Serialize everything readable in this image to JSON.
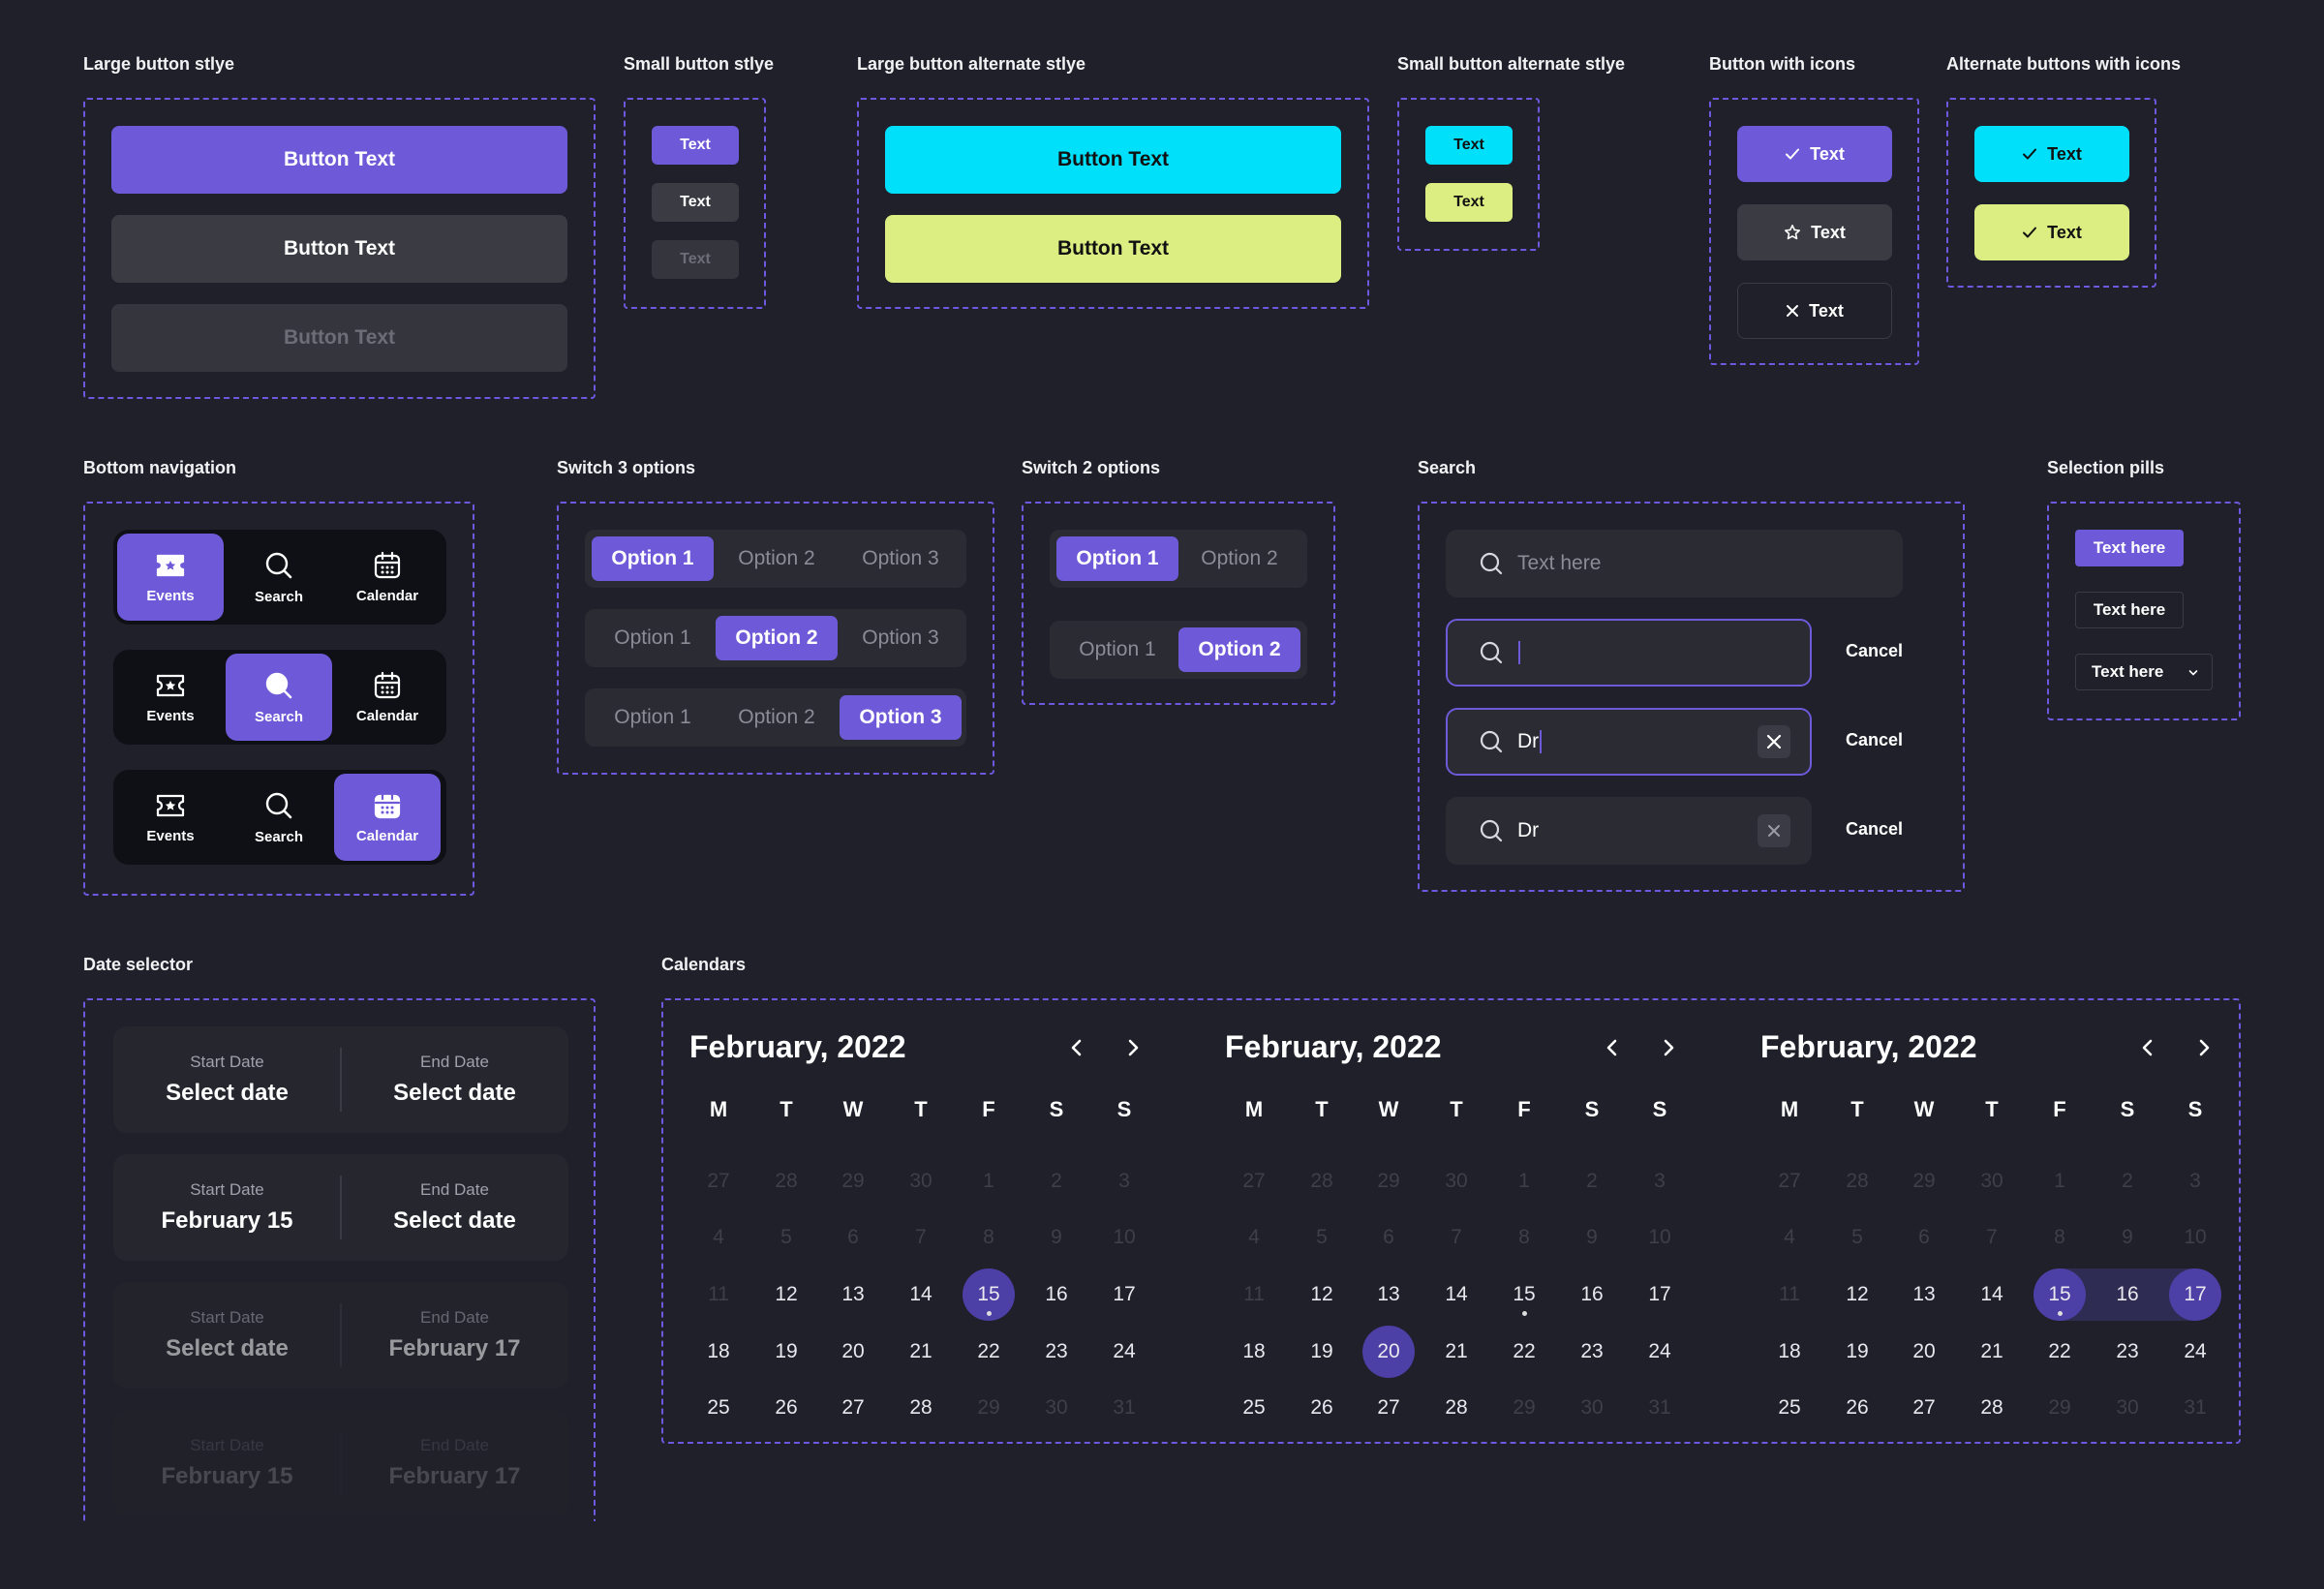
{
  "titles": {
    "large_button": "Large button stlye",
    "small_button": "Small button stlye",
    "large_alt": "Large button alternate stlye",
    "small_alt": "Small button alternate stlye",
    "button_icons": "Button with icons",
    "alt_icons": "Alternate buttons with icons",
    "bottom_nav": "Bottom navigation",
    "switch3": "Switch 3 options",
    "switch2": "Switch 2 options",
    "search": "Search",
    "pills": "Selection pills",
    "date_selector": "Date selector",
    "calendars": "Calendars"
  },
  "large_buttons": [
    "Button Text",
    "Button Text",
    "Button Text"
  ],
  "small_buttons": [
    "Text",
    "Text",
    "Text"
  ],
  "large_alt_buttons": [
    "Button Text",
    "Button Text"
  ],
  "small_alt_buttons": [
    "Text",
    "Text"
  ],
  "icon_buttons": [
    "Text",
    "Text",
    "Text"
  ],
  "alt_icon_buttons": [
    "Text",
    "Text"
  ],
  "bottom_nav": {
    "items": [
      "Events",
      "Search",
      "Calendar"
    ],
    "active_per_row": [
      0,
      1,
      2
    ]
  },
  "switch3": {
    "options": [
      "Option 1",
      "Option 2",
      "Option 3"
    ],
    "selected_per_row": [
      0,
      1,
      2
    ]
  },
  "switch2": {
    "options": [
      "Option 1",
      "Option 2"
    ],
    "selected_per_row": [
      0,
      1
    ]
  },
  "search": {
    "placeholder": "Text here",
    "typed": "Dr",
    "cancel": "Cancel"
  },
  "pills": [
    "Text here",
    "Text here",
    "Text here"
  ],
  "date_selector": {
    "start_caption": "Start Date",
    "end_caption": "End Date",
    "rows": [
      {
        "start": "Select date",
        "end": "Select date"
      },
      {
        "start": "February 15",
        "end": "Select date"
      },
      {
        "start": "Select date",
        "end": "February 17"
      },
      {
        "start": "February 15",
        "end": "February 17"
      }
    ]
  },
  "calendar": {
    "title": "February, 2022",
    "weekdays": [
      "M",
      "T",
      "W",
      "T",
      "F",
      "S",
      "S"
    ],
    "weeks": [
      [
        "27",
        "28",
        "29",
        "30",
        "1",
        "2",
        "3"
      ],
      [
        "4",
        "5",
        "6",
        "7",
        "8",
        "9",
        "10"
      ],
      [
        "11",
        "12",
        "13",
        "14",
        "15",
        "16",
        "17"
      ],
      [
        "18",
        "19",
        "20",
        "21",
        "22",
        "23",
        "24"
      ],
      [
        "25",
        "26",
        "27",
        "28",
        "29",
        "30",
        "31"
      ]
    ],
    "variants": [
      {
        "selected": [
          "15"
        ],
        "today": "15"
      },
      {
        "selected": [
          "20"
        ],
        "today": "15"
      },
      {
        "selected": [
          "15",
          "17"
        ],
        "range_middle": [
          "16"
        ],
        "today": "15"
      }
    ]
  },
  "colors": {
    "background": "#1f2029",
    "primary": "#6e5ad8",
    "cyan": "#00e0fb",
    "lime": "#dcee82",
    "dashed_border": "#6b5ae0"
  }
}
